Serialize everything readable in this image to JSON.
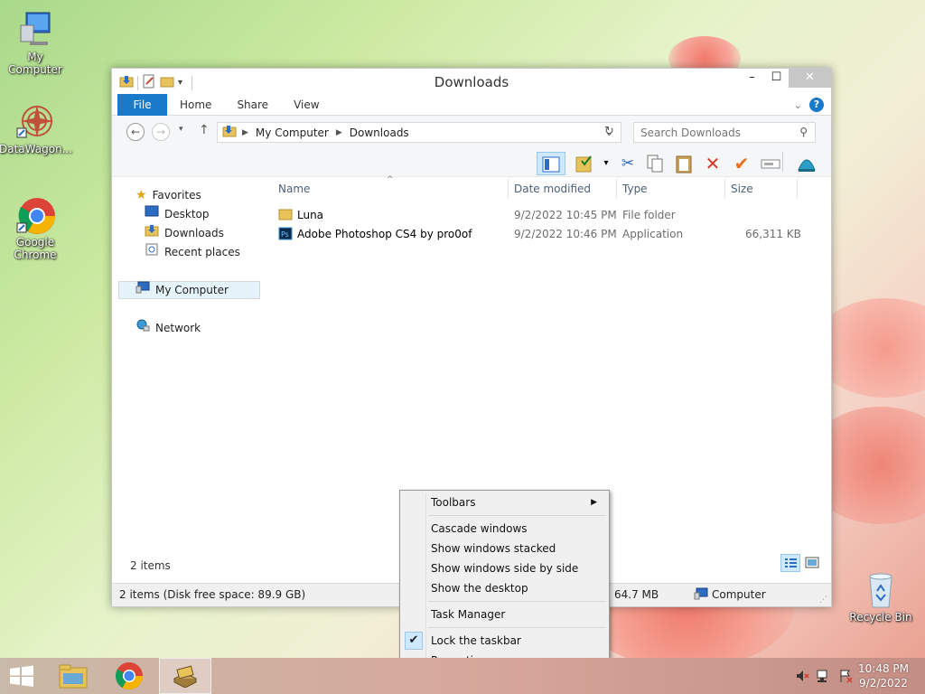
{
  "desktop": {
    "icons": [
      {
        "label": "My Computer"
      },
      {
        "label": "DataWagon..."
      },
      {
        "label": "Google Chrome"
      },
      {
        "label": "Recycle Bin"
      }
    ]
  },
  "window": {
    "title": "Downloads",
    "tabs": [
      "File",
      "Home",
      "Share",
      "View"
    ],
    "address": {
      "crumbs": [
        "My Computer",
        "Downloads"
      ]
    },
    "search": {
      "placeholder": "Search Downloads"
    },
    "nav": {
      "favorites": "Favorites",
      "desktop": "Desktop",
      "downloads": "Downloads",
      "recent": "Recent places",
      "computer": "My Computer",
      "network": "Network"
    },
    "columns": {
      "name": "Name",
      "date": "Date modified",
      "type": "Type",
      "size": "Size"
    },
    "files": [
      {
        "name": "Luna",
        "date": "9/2/2022 10:45 PM",
        "type": "File folder",
        "size": ""
      },
      {
        "name": "Adobe Photoshop CS4 by pro0of",
        "date": "9/2/2022 10:46 PM",
        "type": "Application",
        "size": "66,311 KB"
      }
    ],
    "status": {
      "count": "2 items",
      "detail": "2 items (Disk free space: 89.9 GB)",
      "size": "64.7 MB",
      "location": "Computer"
    }
  },
  "context_menu": {
    "items": {
      "toolbars": "Toolbars",
      "cascade": "Cascade windows",
      "stacked": "Show windows stacked",
      "side": "Show windows side by side",
      "desktop": "Show the desktop",
      "taskmgr": "Task Manager",
      "lock": "Lock the taskbar",
      "properties": "Properties"
    }
  },
  "taskbar": {
    "time": "10:48 PM",
    "date": "9/2/2022"
  },
  "colors": {
    "accent": "#1979ca",
    "ribbon_bg": "#f5f6f7"
  }
}
